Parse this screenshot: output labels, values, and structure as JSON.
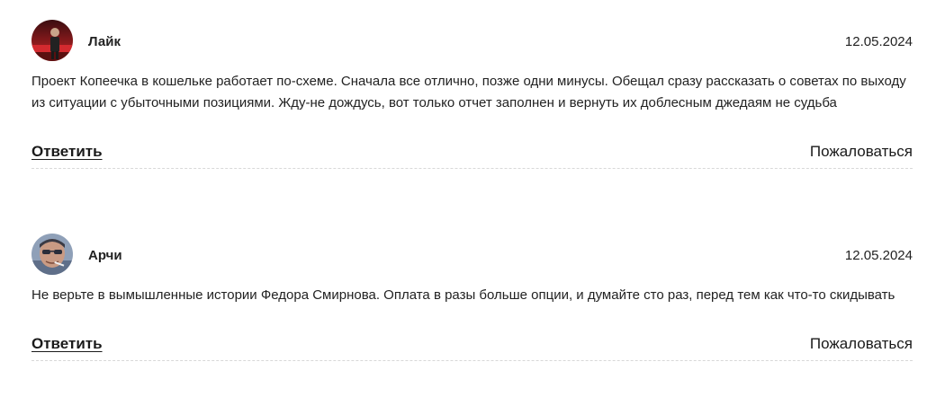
{
  "comments": [
    {
      "author": "Лайк",
      "date": "12.05.2024",
      "text": "Проект Копеечка в кошельке работает по-схеме. Сначала все отлично, позже одни минусы. Обещал сразу рассказать о советах по выходу из ситуации с убыточными позициями. Жду-не дождусь, вот только отчет заполнен и вернуть их доблесным джедаям не судьба",
      "reply_label": "Ответить",
      "report_label": "Пожаловаться"
    },
    {
      "author": "Арчи",
      "date": "12.05.2024",
      "text": "Не верьте в вымышленные истории Федора Смирнова. Оплата в разы больше опции, и думайте сто раз, перед тем как что-то скидывать",
      "reply_label": "Ответить",
      "report_label": "Пожаловаться"
    }
  ]
}
